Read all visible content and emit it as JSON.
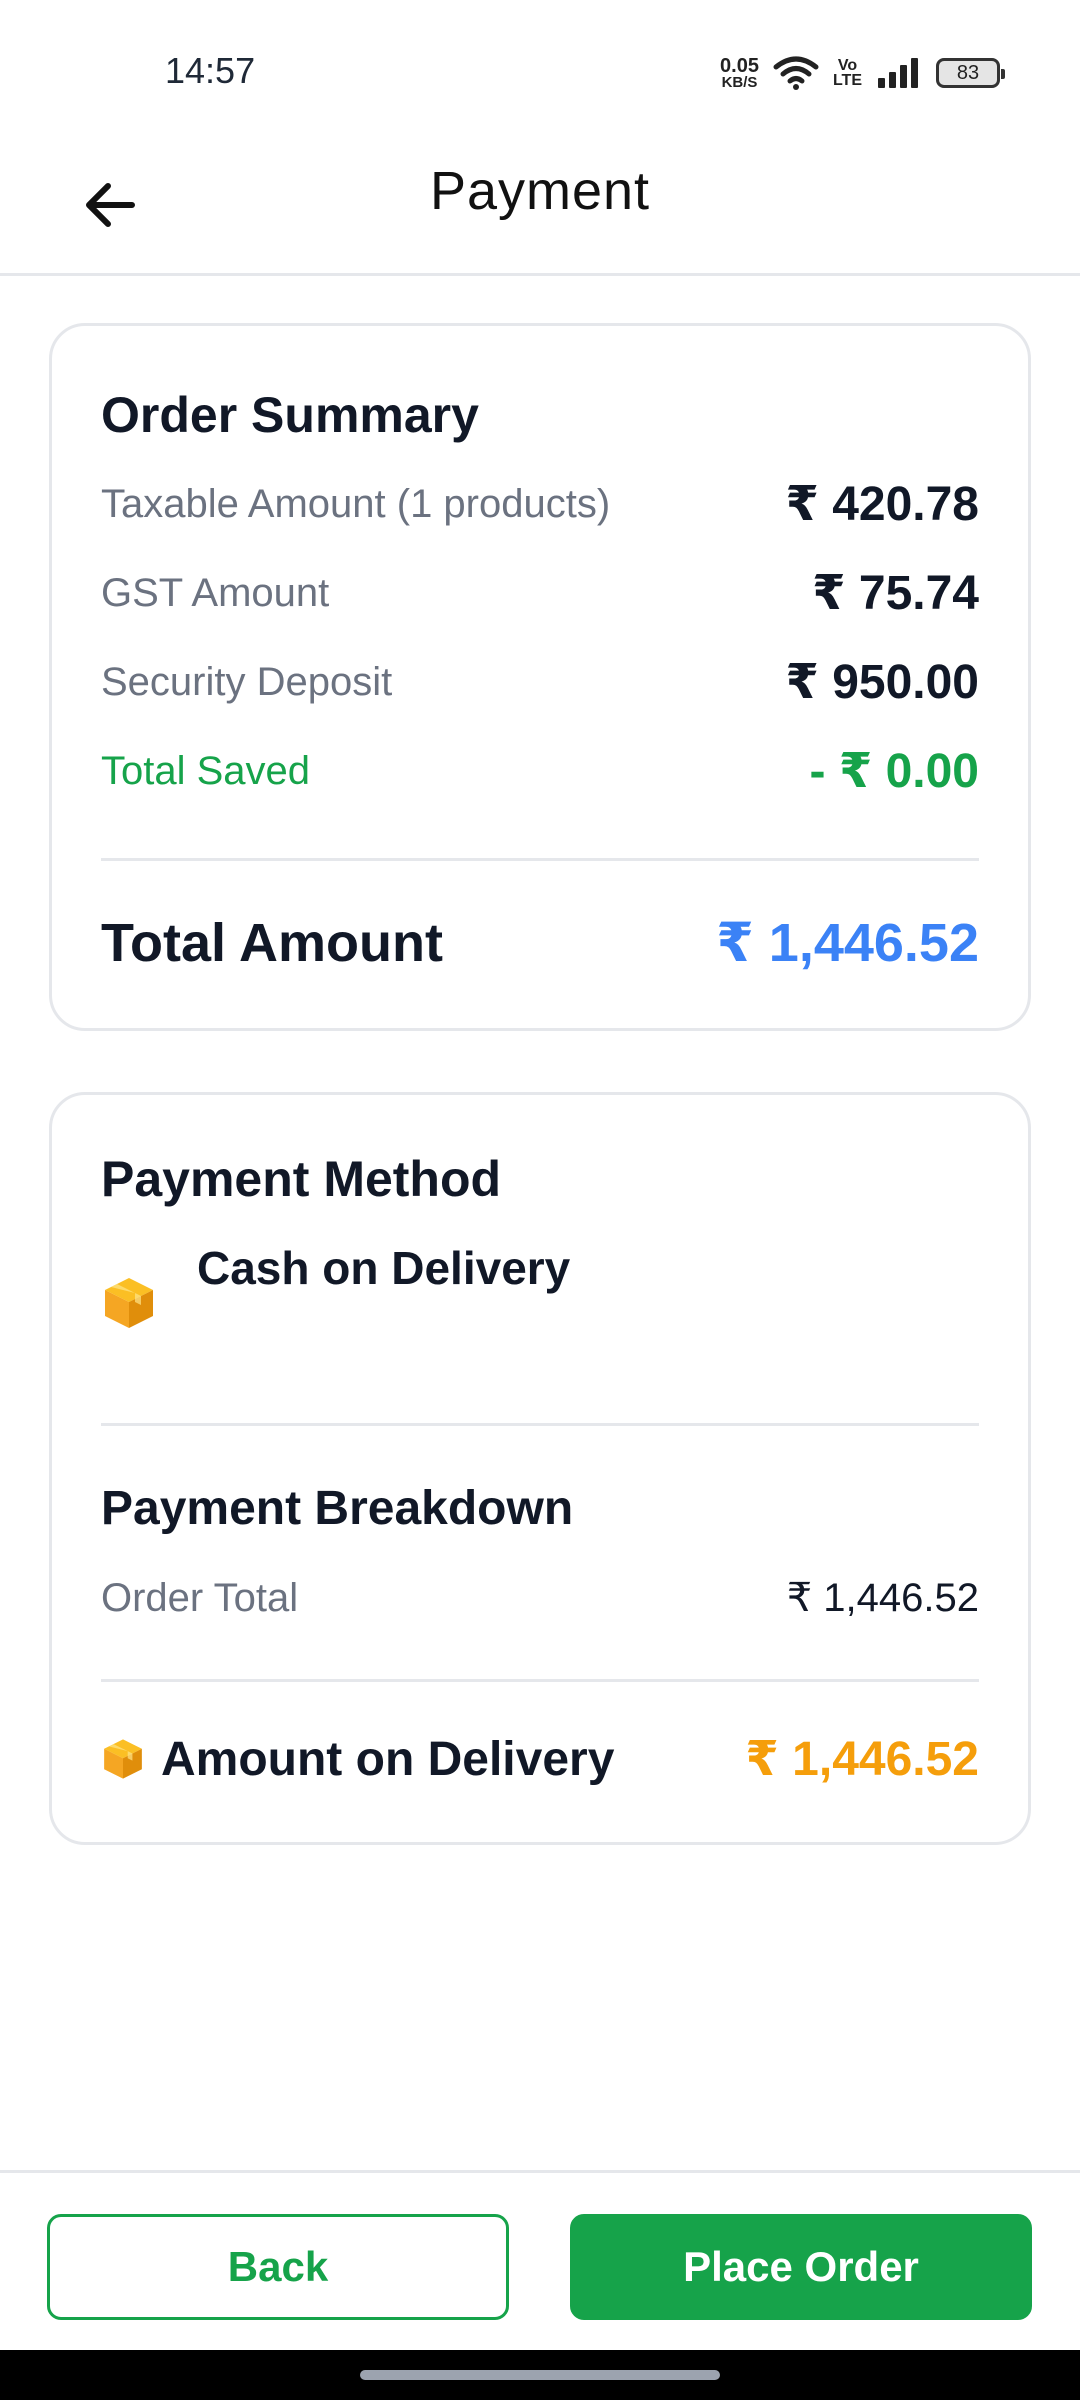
{
  "status_bar": {
    "time": "14:57",
    "net_speed_value": "0.05",
    "net_speed_unit": "KB/S",
    "volte_top": "Vo",
    "volte_bottom": "LTE",
    "battery": "83"
  },
  "header": {
    "title": "Payment"
  },
  "order_summary": {
    "title": "Order Summary",
    "rows": [
      {
        "label": "Taxable Amount (1 products)",
        "value": "₹ 420.78"
      },
      {
        "label": "GST Amount",
        "value": "₹ 75.74"
      },
      {
        "label": "Security Deposit",
        "value": "₹ 950.00"
      },
      {
        "label": "Total Saved",
        "value": "- ₹ 0.00"
      }
    ],
    "total_label": "Total Amount",
    "total_value": "₹ 1,446.52"
  },
  "payment_method": {
    "title": "Payment Method",
    "method_label": "Cash on Delivery",
    "method_icon": "box-icon",
    "breakdown_title": "Payment Breakdown",
    "order_total_label": "Order Total",
    "order_total_value": "₹ 1,446.52",
    "delivery_label": "Amount on Delivery",
    "delivery_value": "₹ 1,446.52"
  },
  "footer": {
    "back_label": "Back",
    "place_order_label": "Place Order"
  },
  "colors": {
    "accent_green": "#16a34a",
    "total_blue": "#3b82f6",
    "delivery_orange": "#f59e0b",
    "icon_orange": "#f5a623"
  }
}
